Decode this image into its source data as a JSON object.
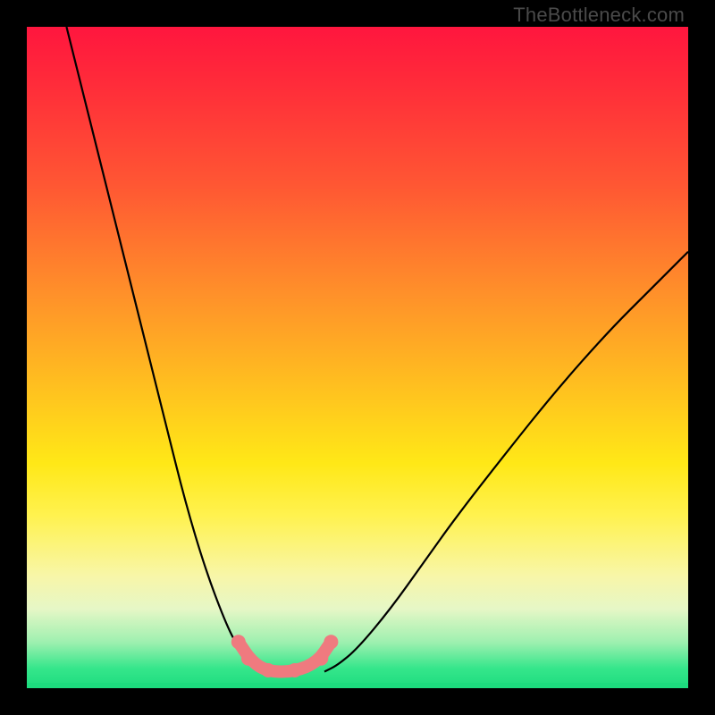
{
  "watermark": "TheBottleneck.com",
  "colors": {
    "black": "#000000",
    "pink_accent": "#ef7a7f",
    "gradient_top": "#ff163e",
    "gradient_bottom": "#1ddc7e"
  },
  "chart_data": {
    "type": "line",
    "title": "",
    "xlabel": "",
    "ylabel": "",
    "xlim": [
      0,
      100
    ],
    "ylim": [
      0,
      100
    ],
    "grid": false,
    "legend": false,
    "series": [
      {
        "name": "left_curve",
        "x": [
          6,
          9,
          12,
          15,
          18,
          21,
          24,
          27,
          30,
          32,
          34,
          35.5,
          36.5
        ],
        "y": [
          100,
          88,
          76,
          64,
          52,
          40,
          28,
          18,
          10,
          6,
          4,
          3,
          2.5
        ]
      },
      {
        "name": "right_curve",
        "x": [
          45,
          47,
          50,
          55,
          60,
          65,
          72,
          80,
          88,
          94,
          100
        ],
        "y": [
          2.5,
          3.5,
          6,
          12,
          19,
          26,
          35,
          45,
          54,
          60,
          66
        ]
      },
      {
        "name": "pink_bottom_path",
        "x": [
          32,
          34,
          36.5,
          40.5,
          44,
          46
        ],
        "y": [
          7,
          4,
          2.5,
          2.5,
          4,
          7
        ]
      },
      {
        "name": "pink_dots",
        "x": [
          32,
          33.5,
          36.5,
          40.5,
          44.5,
          46
        ],
        "y": [
          7,
          4.5,
          2.7,
          2.7,
          4.5,
          7
        ]
      }
    ],
    "annotations": [],
    "notes": "Values are approximate readings from an unlabeled bottleneck-style V-curve plot with a heat-gradient background. x and y are in percent of plot width/height (origin bottom-left). No axis ticks or numeric labels are visible in the source image; only the watermark text is present."
  }
}
